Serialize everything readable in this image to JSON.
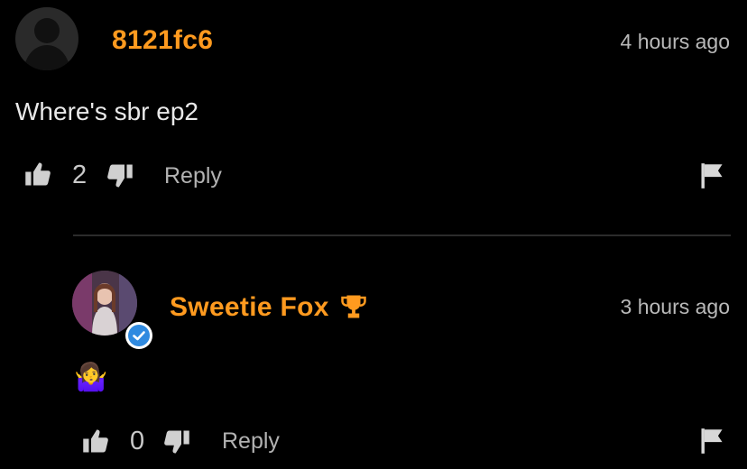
{
  "comment": {
    "username": "8121fc6",
    "timestamp": "4 hours ago",
    "text": "Where's sbr ep2",
    "likes": "2",
    "reply_label": "Reply"
  },
  "reply": {
    "username": "Sweetie Fox",
    "timestamp": "3 hours ago",
    "text": "🤷‍♀️",
    "likes": "0",
    "reply_label": "Reply"
  },
  "colors": {
    "background": "#000000",
    "username": "#ff9a1f",
    "verified": "#2f8ae0"
  },
  "icons": [
    "default-avatar-icon",
    "thumbs-up-icon",
    "thumbs-down-icon",
    "flag-icon",
    "trophy-icon",
    "verified-check-icon"
  ]
}
